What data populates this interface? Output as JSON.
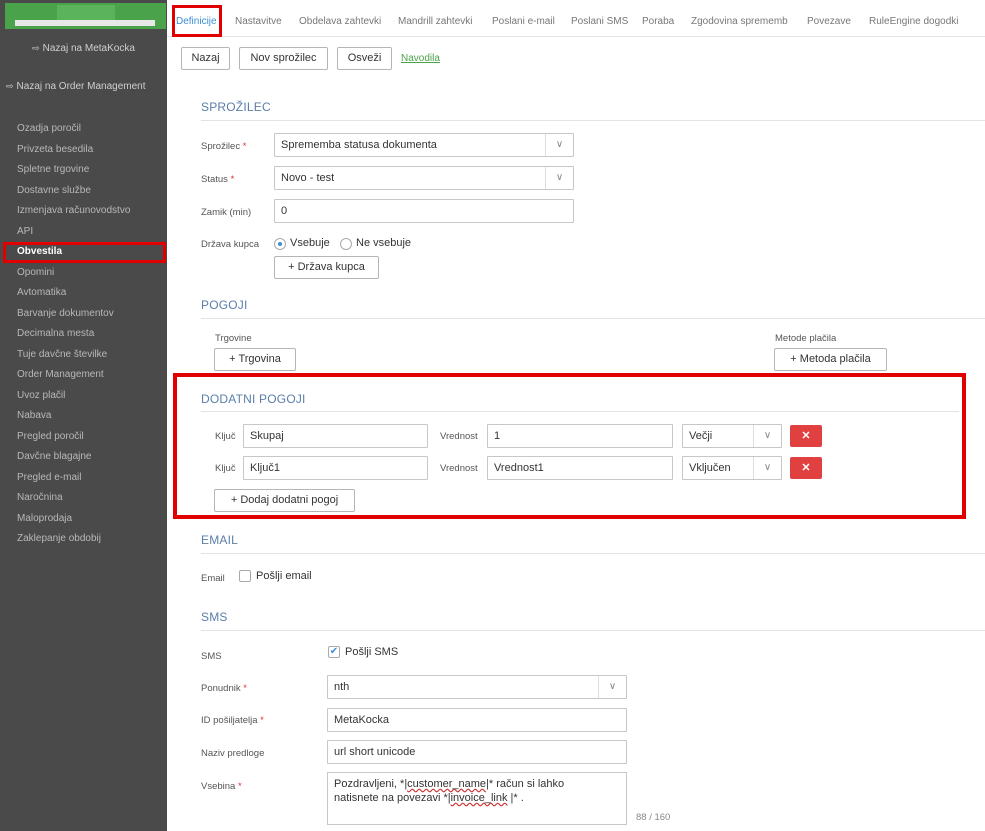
{
  "sidebar": {
    "back_metakocka": "Nazaj na MetaKocka",
    "back_order_management": "Nazaj na Order Management",
    "items": [
      {
        "label": "Ozadja poročil"
      },
      {
        "label": "Privzeta besedila"
      },
      {
        "label": "Spletne trgovine"
      },
      {
        "label": "Dostavne službe"
      },
      {
        "label": "Izmenjava računovodstvo"
      },
      {
        "label": "API"
      },
      {
        "label": "Obvestila"
      },
      {
        "label": "Opomini"
      },
      {
        "label": "Avtomatika"
      },
      {
        "label": "Barvanje dokumentov"
      },
      {
        "label": "Decimalna mesta"
      },
      {
        "label": "Tuje davčne številke"
      },
      {
        "label": "Order Management"
      },
      {
        "label": "Uvoz plačil"
      },
      {
        "label": "Nabava"
      },
      {
        "label": "Pregled poročil"
      },
      {
        "label": "Davčne blagajne"
      },
      {
        "label": "Pregled e-mail"
      },
      {
        "label": "Naročnina"
      },
      {
        "label": "Maloprodaja"
      },
      {
        "label": "Zaklepanje obdobij"
      }
    ]
  },
  "tabs": [
    "Definicije",
    "Nastavitve",
    "Obdelava zahtevki",
    "Mandrill zahtevki",
    "Poslani e-mail",
    "Poslani SMS",
    "Poraba",
    "Zgodovina sprememb",
    "Povezave",
    "RuleEngine dogodki"
  ],
  "toolbar": {
    "back": "Nazaj",
    "new_trigger": "Nov sprožilec",
    "refresh": "Osveži",
    "instructions": "Navodila"
  },
  "trigger_section": {
    "title": "SPROŽILEC",
    "trigger_label": "Sprožilec",
    "trigger_value": "Sprememba statusa dokumenta",
    "status_label": "Status",
    "status_value": "Novo - test",
    "delay_label": "Zamik (min)",
    "delay_value": "0",
    "country_label": "Država kupca",
    "contains": "Vsebuje",
    "not_contains": "Ne vsebuje",
    "add_country": "Država kupca"
  },
  "conditions": {
    "title": "POGOJI",
    "shops_label": "Trgovine",
    "add_shop": "Trgovina",
    "payment_label": "Metode plačila",
    "add_payment": "Metoda plačila"
  },
  "extra_conditions": {
    "title": "DODATNI POGOJI",
    "key_label": "Ključ",
    "value_label": "Vrednost",
    "rows": [
      {
        "key": "Skupaj",
        "value": "1",
        "op": "Večji"
      },
      {
        "key": "Ključ1",
        "value": "Vrednost1",
        "op": "Vključen"
      }
    ],
    "add": "Dodaj dodatni pogoj"
  },
  "email": {
    "title": "EMAIL",
    "label": "Email",
    "send": "Pošlji email"
  },
  "sms": {
    "title": "SMS",
    "label": "SMS",
    "send": "Pošlji SMS",
    "provider_label": "Ponudnik",
    "provider_value": "nth",
    "sender_label": "ID pošiljatelja",
    "sender_value": "MetaKocka",
    "template_label": "Naziv predloge",
    "template_value": "url short unicode",
    "content_label": "Vsebina",
    "content_line1_a": "Pozdravljeni, *|",
    "content_line1_b": "customer_name",
    "content_line1_c": "|* račun si lahko",
    "content_line2_a": "natisnete na povezavi *|",
    "content_line2_b": "invoice_link",
    "content_line2_c": " |* .",
    "counter": "88 / 160"
  }
}
